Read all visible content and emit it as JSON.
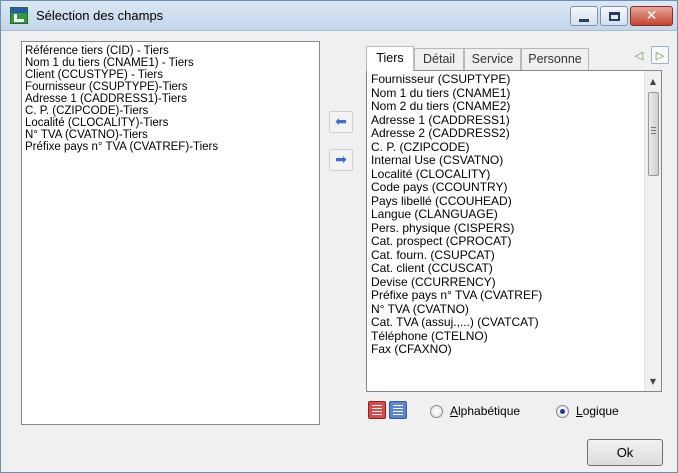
{
  "window": {
    "title": "Sélection des champs"
  },
  "left_list": {
    "items": [
      "Référence tiers (CID) - Tiers",
      "Nom 1 du tiers (CNAME1) - Tiers",
      "Client (CCUSTYPE) - Tiers",
      "Fournisseur (CSUPTYPE)-Tiers",
      "Adresse 1 (CADDRESS1)-Tiers",
      "C. P. (CZIPCODE)-Tiers",
      "Localité (CLOCALITY)-Tiers",
      "N° TVA (CVATNO)-Tiers",
      "Préfixe pays n° TVA (CVATREF)-Tiers"
    ]
  },
  "tabs": [
    "Tiers",
    "Détail",
    "Service",
    "Personne"
  ],
  "active_tab": "Tiers",
  "right_list": {
    "items": [
      "Fournisseur (CSUPTYPE)",
      "Nom 1 du tiers (CNAME1)",
      "Nom 2 du tiers (CNAME2)",
      "Adresse 1 (CADDRESS1)",
      "Adresse 2 (CADDRESS2)",
      "C. P. (CZIPCODE)",
      "Internal Use (CSVATNO)",
      "Localité (CLOCALITY)",
      "Code pays (CCOUNTRY)",
      "Pays libellé (CCOUHEAD)",
      "Langue (CLANGUAGE)",
      "Pers. physique (CISPERS)",
      "Cat. prospect (CPROCAT)",
      "Cat. fourn. (CSUPCAT)",
      "Cat. client (CCUSCAT)",
      "Devise (CCURRENCY)",
      "Préfixe pays n° TVA (CVATREF)",
      "N° TVA (CVATNO)",
      "Cat. TVA (assuj.,...) (CVATCAT)",
      "Téléphone (CTELNO)",
      "Fax (CFAXNO)"
    ]
  },
  "sort": {
    "alpha_prefix": "A",
    "alpha_rest": "lphabétique",
    "logic_prefix": "L",
    "logic_rest": "ogique",
    "selected": "Logique"
  },
  "ok_label": "Ok",
  "icons": {
    "app": "app-logo-icon",
    "minimize": "minimize-icon",
    "maximize": "maximize-icon",
    "close": "close-icon",
    "move_left": "arrow-left-icon",
    "move_right": "arrow-right-icon",
    "tab_prev": "chevron-left-icon",
    "tab_next": "chevron-right-icon"
  }
}
